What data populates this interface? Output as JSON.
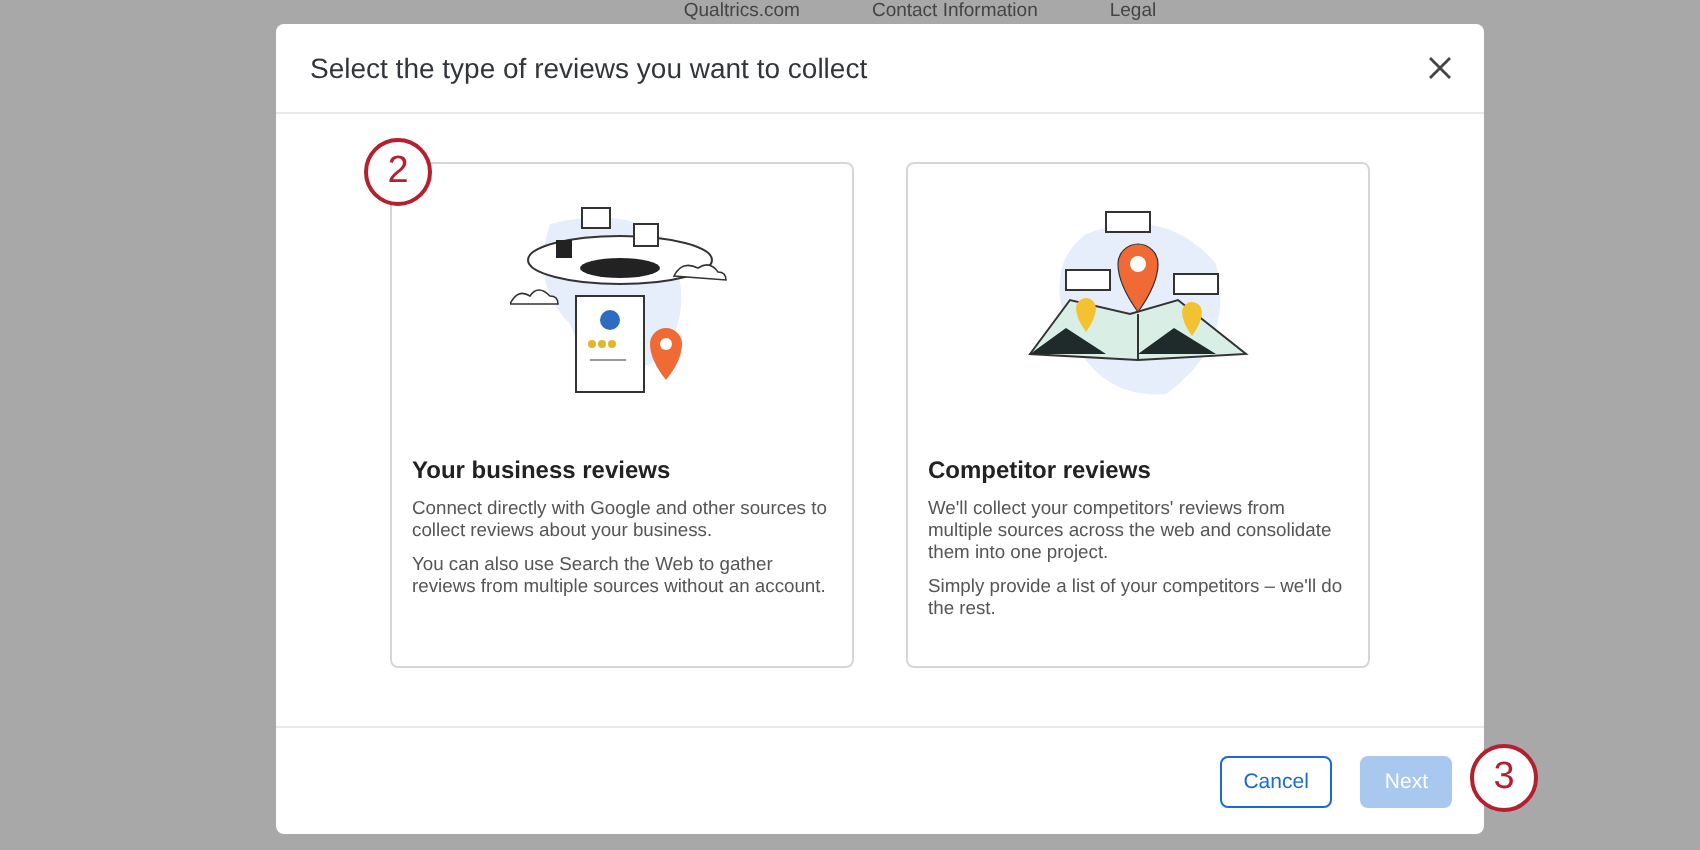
{
  "page_links": [
    "Qualtrics.com",
    "Contact Information",
    "Legal"
  ],
  "dialog": {
    "title": "Select the type of reviews you want to collect",
    "cards": [
      {
        "kind": "business",
        "selected": false,
        "title": "Your business reviews",
        "paragraphs": [
          "Connect directly with Google and other sources to collect reviews about your business.",
          "You can also use Search the Web to gather reviews from multiple sources without an account."
        ]
      },
      {
        "kind": "competitor",
        "selected": false,
        "title": "Competitor reviews",
        "paragraphs": [
          "We'll collect your competitors' reviews from multiple sources across the web and consolidate them into one project.",
          "Simply provide a list of your competitors – we'll do the rest."
        ]
      }
    ],
    "buttons": [
      {
        "label": "Cancel",
        "kind": "secondary",
        "disabled": false
      },
      {
        "label": "Next",
        "kind": "primary",
        "disabled": true
      }
    ]
  },
  "annotations": [
    "2",
    "3"
  ]
}
